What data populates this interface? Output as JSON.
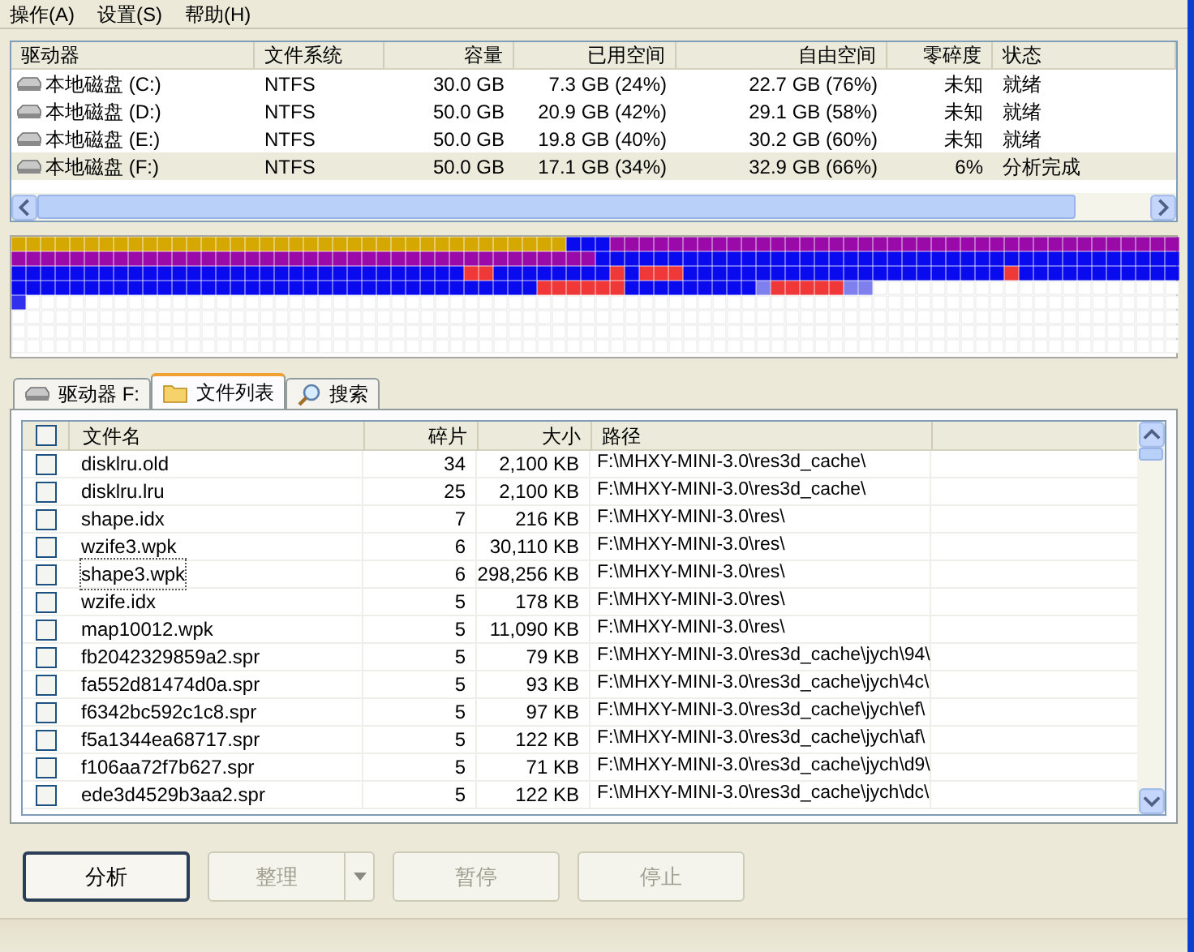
{
  "menu": [
    {
      "label": "操作(A)"
    },
    {
      "label": "设置(S)"
    },
    {
      "label": "帮助(H)"
    }
  ],
  "drives": {
    "columns": [
      "驱动器",
      "文件系统",
      "容量",
      "已用空间",
      "自由空间",
      "零碎度",
      "状态"
    ],
    "rows": [
      {
        "cells": [
          "本地磁盘 (C:)",
          "NTFS",
          "30.0 GB",
          "7.3 GB (24%)",
          "22.7 GB (76%)",
          "未知",
          "就绪"
        ],
        "selected": false
      },
      {
        "cells": [
          "本地磁盘 (D:)",
          "NTFS",
          "50.0 GB",
          "20.9 GB (42%)",
          "29.1 GB (58%)",
          "未知",
          "就绪"
        ],
        "selected": false
      },
      {
        "cells": [
          "本地磁盘 (E:)",
          "NTFS",
          "50.0 GB",
          "19.8 GB (40%)",
          "30.2 GB (60%)",
          "未知",
          "就绪"
        ],
        "selected": false
      },
      {
        "cells": [
          "本地磁盘 (F:)",
          "NTFS",
          "50.0 GB",
          "17.1 GB (34%)",
          "32.9 GB (66%)",
          "6%",
          "分析完成"
        ],
        "selected": true
      }
    ]
  },
  "tabs": [
    {
      "label": "驱动器 F:",
      "kind": "drive",
      "selected": false
    },
    {
      "label": "文件列表",
      "kind": "folder",
      "selected": true
    },
    {
      "label": "搜索",
      "kind": "search",
      "selected": false
    }
  ],
  "files": {
    "columns": [
      "文件名",
      "碎片",
      "大小",
      "路径"
    ],
    "header_checked": false,
    "rows": [
      {
        "name": "disklru.old",
        "fragments": "34",
        "size": "2,100 KB",
        "path": "F:\\MHXY-MINI-3.0\\res3d_cache\\",
        "checked": false,
        "focused": false
      },
      {
        "name": "disklru.lru",
        "fragments": "25",
        "size": "2,100 KB",
        "path": "F:\\MHXY-MINI-3.0\\res3d_cache\\",
        "checked": false,
        "focused": false
      },
      {
        "name": "shape.idx",
        "fragments": "7",
        "size": "216 KB",
        "path": "F:\\MHXY-MINI-3.0\\res\\",
        "checked": false,
        "focused": false
      },
      {
        "name": "wzife3.wpk",
        "fragments": "6",
        "size": "30,110 KB",
        "path": "F:\\MHXY-MINI-3.0\\res\\",
        "checked": false,
        "focused": false
      },
      {
        "name": "shape3.wpk",
        "fragments": "6",
        "size": "298,256 KB",
        "path": "F:\\MHXY-MINI-3.0\\res\\",
        "checked": false,
        "focused": true
      },
      {
        "name": "wzife.idx",
        "fragments": "5",
        "size": "178 KB",
        "path": "F:\\MHXY-MINI-3.0\\res\\",
        "checked": false,
        "focused": false
      },
      {
        "name": "map10012.wpk",
        "fragments": "5",
        "size": "11,090 KB",
        "path": "F:\\MHXY-MINI-3.0\\res\\",
        "checked": false,
        "focused": false
      },
      {
        "name": "fb2042329859a2.spr",
        "fragments": "5",
        "size": "79 KB",
        "path": "F:\\MHXY-MINI-3.0\\res3d_cache\\jych\\94\\",
        "checked": false,
        "focused": false
      },
      {
        "name": "fa552d81474d0a.spr",
        "fragments": "5",
        "size": "93 KB",
        "path": "F:\\MHXY-MINI-3.0\\res3d_cache\\jych\\4c\\",
        "checked": false,
        "focused": false
      },
      {
        "name": "f6342bc592c1c8.spr",
        "fragments": "5",
        "size": "97 KB",
        "path": "F:\\MHXY-MINI-3.0\\res3d_cache\\jych\\ef\\",
        "checked": false,
        "focused": false
      },
      {
        "name": "f5a1344ea68717.spr",
        "fragments": "5",
        "size": "122 KB",
        "path": "F:\\MHXY-MINI-3.0\\res3d_cache\\jych\\af\\",
        "checked": false,
        "focused": false
      },
      {
        "name": "f106aa72f7b627.spr",
        "fragments": "5",
        "size": "71 KB",
        "path": "F:\\MHXY-MINI-3.0\\res3d_cache\\jych\\d9\\",
        "checked": false,
        "focused": false
      },
      {
        "name": "ede3d4529b3aa2.spr",
        "fragments": "5",
        "size": "122 KB",
        "path": "F:\\MHXY-MINI-3.0\\res3d_cache\\jych\\dc\\",
        "checked": false,
        "focused": false
      }
    ]
  },
  "buttons": [
    {
      "label": "分析",
      "disabled": false,
      "has_menu": false
    },
    {
      "label": "整理",
      "disabled": true,
      "has_menu": true
    },
    {
      "label": "暂停",
      "disabled": true,
      "has_menu": false
    },
    {
      "label": "停止",
      "disabled": true,
      "has_menu": false
    }
  ]
}
